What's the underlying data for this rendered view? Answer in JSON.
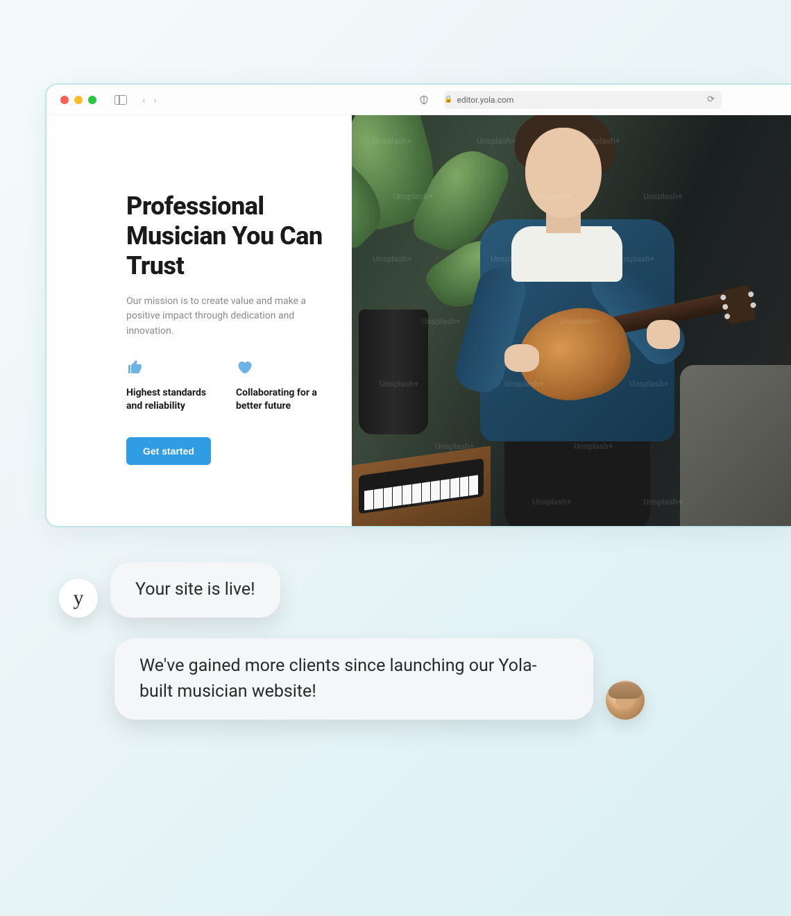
{
  "browser": {
    "url": "editor.yola.com"
  },
  "hero": {
    "title": "Professional Musician You Can Trust",
    "subtitle": "Our mission is to create value and make a positive impact through dedication and innovation.",
    "features": [
      {
        "icon": "thumbs-up-icon",
        "text": "Highest standards and reliability"
      },
      {
        "icon": "heart-icon",
        "text": "Collaborating for a better future"
      }
    ],
    "cta": "Get started",
    "image_watermark": "Unsplash+"
  },
  "chat": {
    "brand_initial": "y",
    "messages": [
      {
        "from": "brand",
        "text": "Your site is live!"
      },
      {
        "from": "user",
        "text": "We've gained more clients since launching our Yola-built musician website!"
      }
    ]
  }
}
